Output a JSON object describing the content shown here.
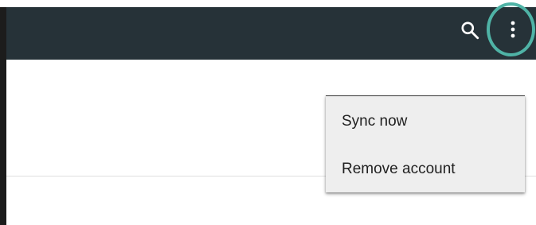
{
  "app_bar": {
    "background": "#263238",
    "actions": [
      {
        "id": "search",
        "icon": "search-icon",
        "color": "#ffffff"
      },
      {
        "id": "more",
        "icon": "more-vert-icon",
        "color": "#ffffff",
        "highlighted": true,
        "highlight_color": "#4fb3a6"
      }
    ]
  },
  "overflow_menu": {
    "background": "#eeeeee",
    "items": [
      {
        "label": "Sync now"
      },
      {
        "label": "Remove account"
      }
    ]
  }
}
